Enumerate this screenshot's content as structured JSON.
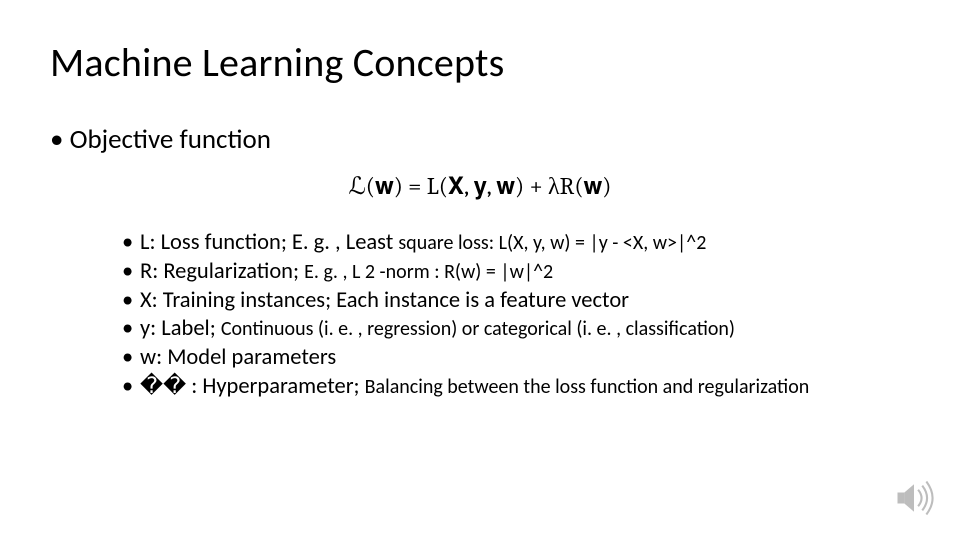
{
  "title": "Machine Learning Concepts",
  "main_bullet": "Objective function",
  "formula": "ℒ(𝐰) = L(𝐗, 𝐲, 𝐰) + λR(𝐰)",
  "items": [
    {
      "lead": "L: Loss function;",
      "mid": " E. g. , Least ",
      "small": "square loss: L(X, y, w) = |y - <X, w>|^2"
    },
    {
      "lead": "R: Regularization; ",
      "mid": "E. g. , L 2 -norm : R(w) = |w|^2",
      "small": ""
    },
    {
      "lead": "X: Training instances; Each instance is  a feature vector",
      "mid": "",
      "small": ""
    },
    {
      "lead": "y: Label; ",
      "mid": "Continuous (i. e. , regression) or categorical (i. e. , classification)",
      "small": ""
    },
    {
      "lead": "w: Model parameters",
      "mid": "",
      "small": ""
    },
    {
      "lead": "�� : Hyperparameter; ",
      "mid": "Balancing between the loss function and regularization",
      "small": ""
    }
  ],
  "icon_label": "audio"
}
